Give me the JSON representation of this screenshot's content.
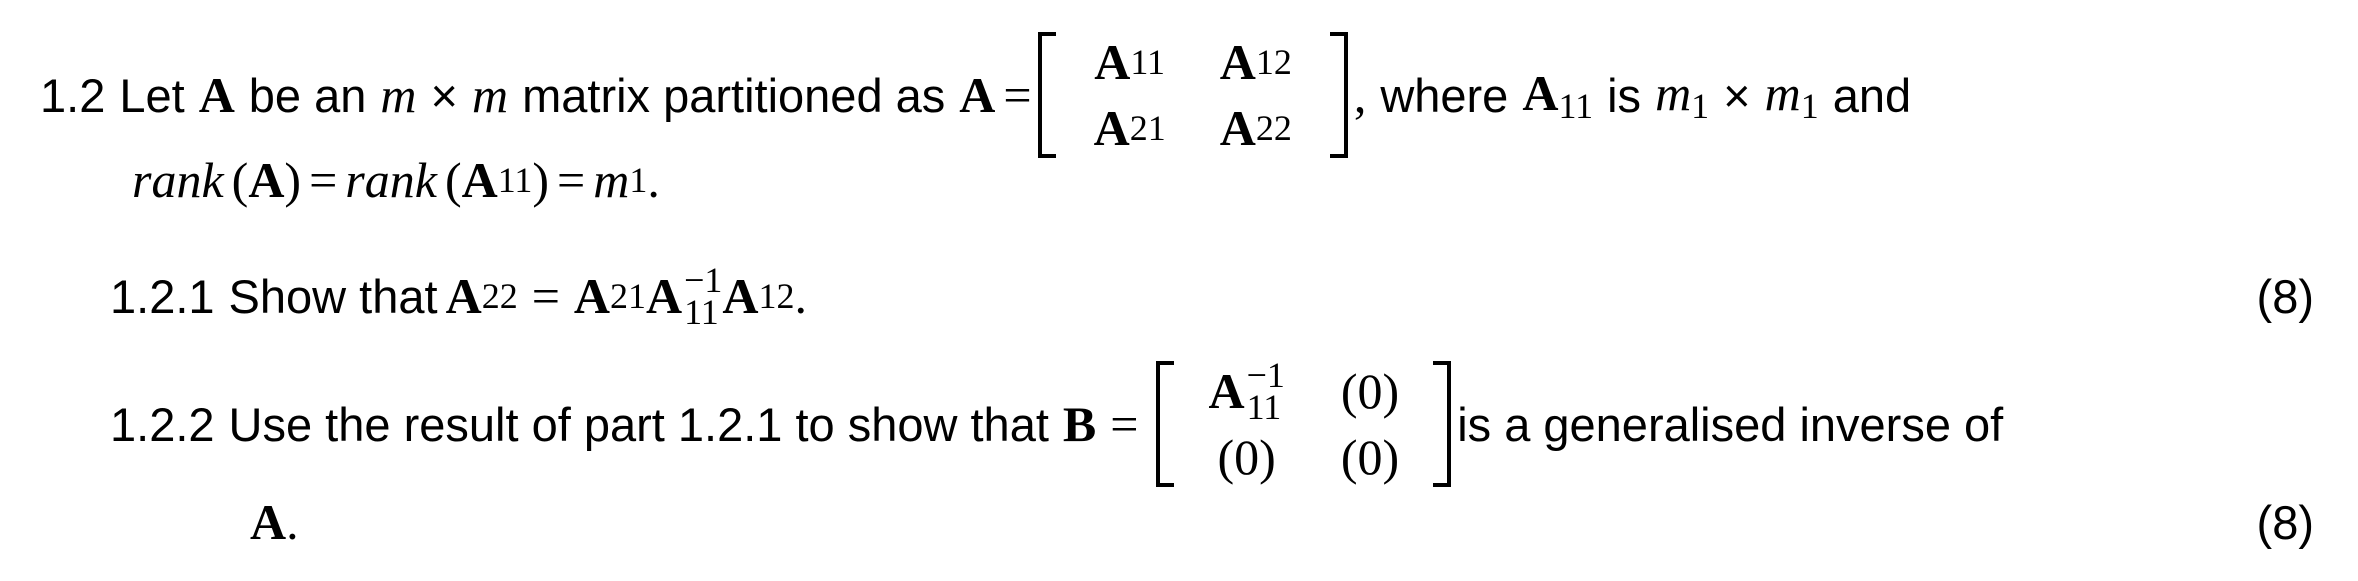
{
  "question": {
    "number": "1.2",
    "intro": {
      "t1": "Let",
      "A": "A",
      "t2": "be an",
      "m": "m",
      "times": "×",
      "t3": "matrix partitioned as",
      "eq": "=",
      "matrix": [
        [
          "A",
          "11"
        ],
        [
          "A",
          "12"
        ],
        [
          "A",
          "21"
        ],
        [
          "A",
          "22"
        ]
      ],
      "comma": ",",
      "t4": "where",
      "A11_base": "A",
      "A11_sub": "11",
      "t5": "is",
      "m1_base": "m",
      "m1_sub": "1",
      "t6": "and"
    },
    "rank_line": {
      "rank": "rank",
      "lp": "(",
      "A": "A",
      "rp": ")",
      "eq": "=",
      "A11_sub": "11",
      "m_sub": "1",
      "period": "."
    }
  },
  "parts": [
    {
      "number": "1.2.1",
      "text": "Show that",
      "lhs_sub": "22",
      "eq": "=",
      "a21_sub": "21",
      "inv_sup": "−1",
      "inv_sub": "11",
      "a12_sub": "12",
      "period": ".",
      "marks": "(8)"
    },
    {
      "number": "1.2.2",
      "text": "Use the result of part 1.2.1 to show that",
      "B": "B",
      "eq": "=",
      "matrix": {
        "a11": "A",
        "a11_sup": "−1",
        "a11_sub": "11",
        "zero": "(0)"
      },
      "text_after": "is a generalised inverse of",
      "cont": "A",
      "cont_period": ".",
      "marks": "(8)"
    }
  ]
}
